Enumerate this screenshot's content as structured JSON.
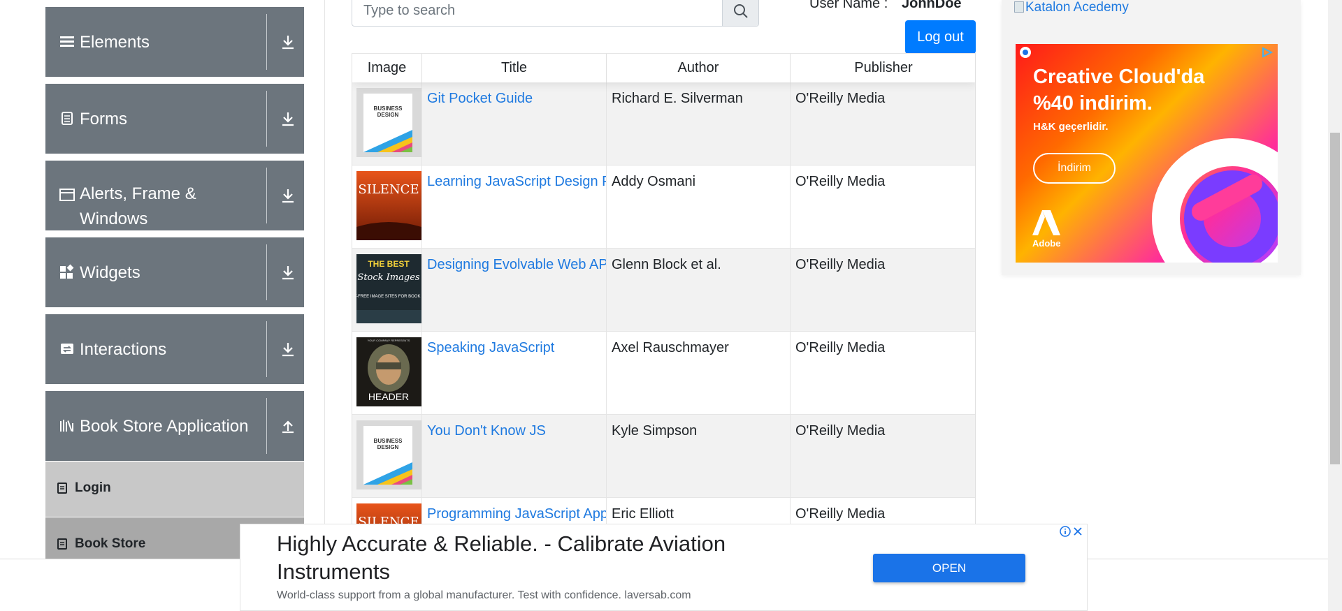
{
  "sidebar": {
    "groups": [
      {
        "label": "Elements",
        "icon": "hamburger-icon"
      },
      {
        "label": "Forms",
        "icon": "document-icon"
      },
      {
        "label": "Alerts, Frame & Windows",
        "icon": "window-icon"
      },
      {
        "label": "Widgets",
        "icon": "widgets-icon"
      },
      {
        "label": "Interactions",
        "icon": "interactions-icon"
      },
      {
        "label": "Book Store Application",
        "icon": "books-icon"
      }
    ],
    "subitems": [
      {
        "label": "Login",
        "icon": "badge-icon"
      },
      {
        "label": "Book Store",
        "icon": "badge-icon"
      }
    ]
  },
  "search": {
    "placeholder": "Type to search"
  },
  "user": {
    "label": "User Name :",
    "value": "JohnDoe"
  },
  "logout_label": "Log out",
  "table": {
    "headers": [
      "Image",
      "Title",
      "Author",
      "Publisher"
    ],
    "rows": [
      {
        "title": "Git Pocket Guide",
        "author": "Richard E. Silverman",
        "publisher": "O'Reilly Media",
        "cover": "business"
      },
      {
        "title": "Learning JavaScript Design Patterns",
        "author": "Addy Osmani",
        "publisher": "O'Reilly Media",
        "cover": "silence"
      },
      {
        "title": "Designing Evolvable Web APIs with ASP.NET",
        "author": "Glenn Block et al.",
        "publisher": "O'Reilly Media",
        "cover": "stock"
      },
      {
        "title": "Speaking JavaScript",
        "author": "Axel Rauschmayer",
        "publisher": "O'Reilly Media",
        "cover": "header"
      },
      {
        "title": "You Don't Know JS",
        "author": "Kyle Simpson",
        "publisher": "O'Reilly Media",
        "cover": "business"
      },
      {
        "title": "Programming JavaScript Applications",
        "author": "Eric Elliott",
        "publisher": "O'Reilly Media",
        "cover": "silence"
      }
    ]
  },
  "covers": {
    "business_top": "BUSINESS",
    "business_bottom": "DESIGN",
    "silence": "SILENCE",
    "stock_top": "THE BEST",
    "stock_script": "Stock Images",
    "stock_lines": "ROYALTY-FREE IMAGE SITES FOR BOOK COVERS",
    "header_top": "YOUR COMPANY REPRESENTS",
    "header_main": "HEADER"
  },
  "ads": {
    "katalon_alt": "Katalon Acedemy",
    "cc_title_1": "Creative Cloud'da",
    "cc_title_2": "%40 indirim.",
    "cc_sub": "H&K geçerlidir.",
    "cc_button": "İndirim",
    "cc_brand": "Adobe",
    "banner_title": "Highly Accurate & Reliable. - Calibrate Aviation Instruments",
    "banner_sub": "World-class support from a global manufacturer. Test with confidence. laversab.com",
    "banner_open": "OPEN"
  },
  "colors": {
    "sidebar_group_bg": "#6c757d",
    "primary": "#007bff",
    "link": "#1f7ae0",
    "login_bg": "#c8c8c8",
    "bookstore_bg": "#a8a8a8"
  }
}
